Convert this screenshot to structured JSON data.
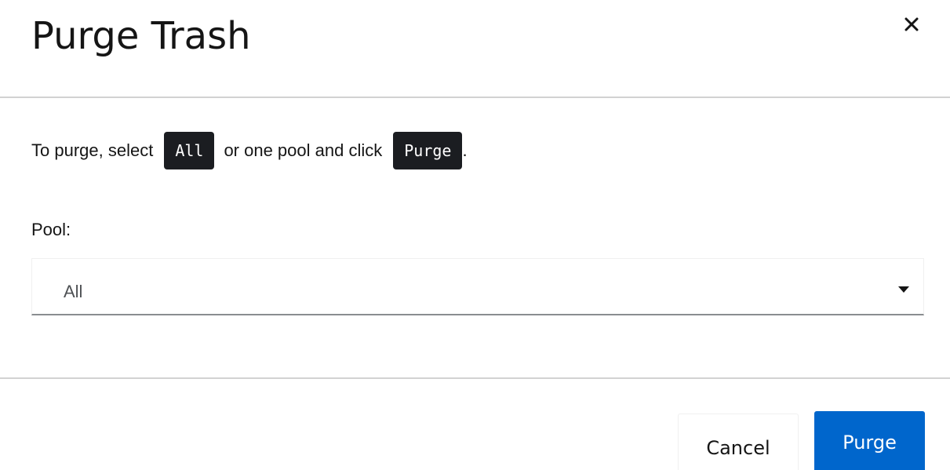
{
  "dialog": {
    "title": "Purge Trash",
    "close_icon": "close-icon"
  },
  "body": {
    "instruction_prefix": "To purge, select",
    "chip_all": "All",
    "instruction_middle": "or one pool and click",
    "chip_purge": "Purge",
    "instruction_suffix": ".",
    "pool_label": "Pool:",
    "pool_select": {
      "selected": "All",
      "caret_icon": "caret-down-icon"
    }
  },
  "footer": {
    "cancel_label": "Cancel",
    "purge_label": "Purge"
  },
  "colors": {
    "primary": "#0066cc",
    "chip_background": "#1b1d21",
    "divider": "#d2d2d2"
  }
}
